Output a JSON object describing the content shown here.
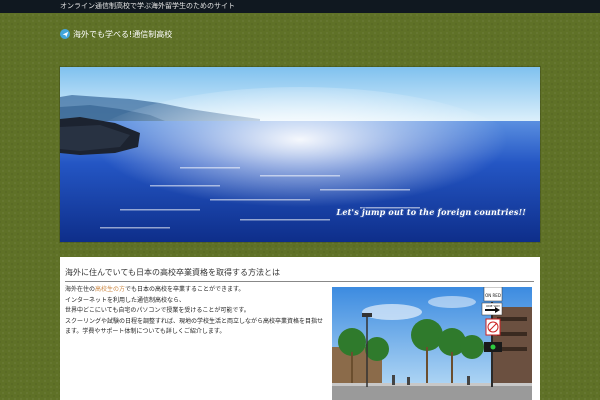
{
  "topbar": {
    "text": "オンライン通信制高校で学ぶ海外留学生のためのサイト"
  },
  "site": {
    "title": "海外でも学べる!通信制高校"
  },
  "hero": {
    "tagline": "Let's jump out to the foreign countries!!",
    "colors": {
      "sky": "#bfe3f7",
      "sea": "#1f55c2",
      "deep_sea": "#0e2e8a"
    }
  },
  "article": {
    "title": "海外に住んでいても日本の高校卒業資格を取得する方法とは",
    "body": {
      "line1_prefix": "海外在住の",
      "line1_link": "高校生の方",
      "line1_suffix": "でも日本の高校を卒業することができます。",
      "line2": "インターネットを利用した通信制高校なら、",
      "line3": "世界中どこにいても自宅のパソコンで授業を受けることが可能です。",
      "line4": "スクーリングや試験の日程を調整すれば、現地の学校生活と両立しながら高校卒業資格を目指せます。学費やサポート体制についても詳しくご紹介します。"
    }
  },
  "photo": {
    "sign_text": "ONE WAY",
    "shop_sign": "ON RED"
  },
  "icons": {
    "site_title_icon": "paper-plane-icon"
  }
}
